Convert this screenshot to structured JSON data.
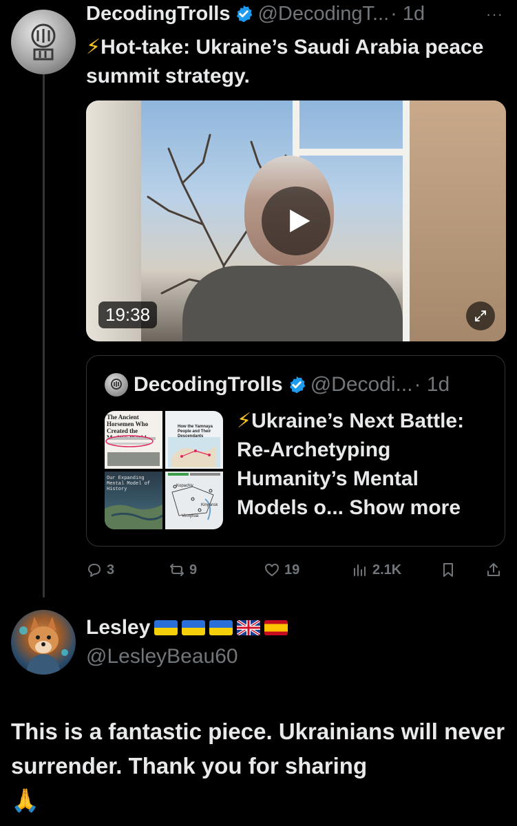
{
  "post": {
    "display_name": "DecodingTrolls",
    "handle": "@DecodingT...",
    "time": "· 1d",
    "more": "···",
    "bolt": "⚡",
    "text": "Hot-take: Ukraine’s Saudi Arabia peace summit strategy.",
    "video": {
      "duration": "19:38"
    },
    "quote": {
      "display_name": "DecodingTrolls",
      "handle": "@Decodi...",
      "time": "· 1d",
      "bolt": "⚡",
      "text": "Ukraine’s Next Battle: Re-Archetyping Humanity’s Mental Models o... Show more",
      "thumbs": {
        "t1": "The Ancient Horsemen Who Created the Modern World",
        "t2": "How the Yamnaya People and Their Descendants Conquered Europe",
        "t3": "Our Expanding Mental Model of History",
        "t4_place_1": "Kopachiv",
        "t4_place_2": "Vinnytsia",
        "t4_place_3": "Kinyansk"
      }
    },
    "actions": {
      "replies": "3",
      "reposts": "9",
      "likes": "19",
      "views": "2.1K"
    }
  },
  "reply": {
    "display_name": "Lesley",
    "handle": "@LesleyBeau60",
    "text": "This is a fantastic piece. Ukrainians will never surrender. Thank you for sharing",
    "emoji": "🙏"
  },
  "colors": {
    "background": "#000000",
    "text": "#e7e9ea",
    "muted": "#71767b",
    "verified": "#1d9bf0",
    "bolt": "#f7c325"
  }
}
